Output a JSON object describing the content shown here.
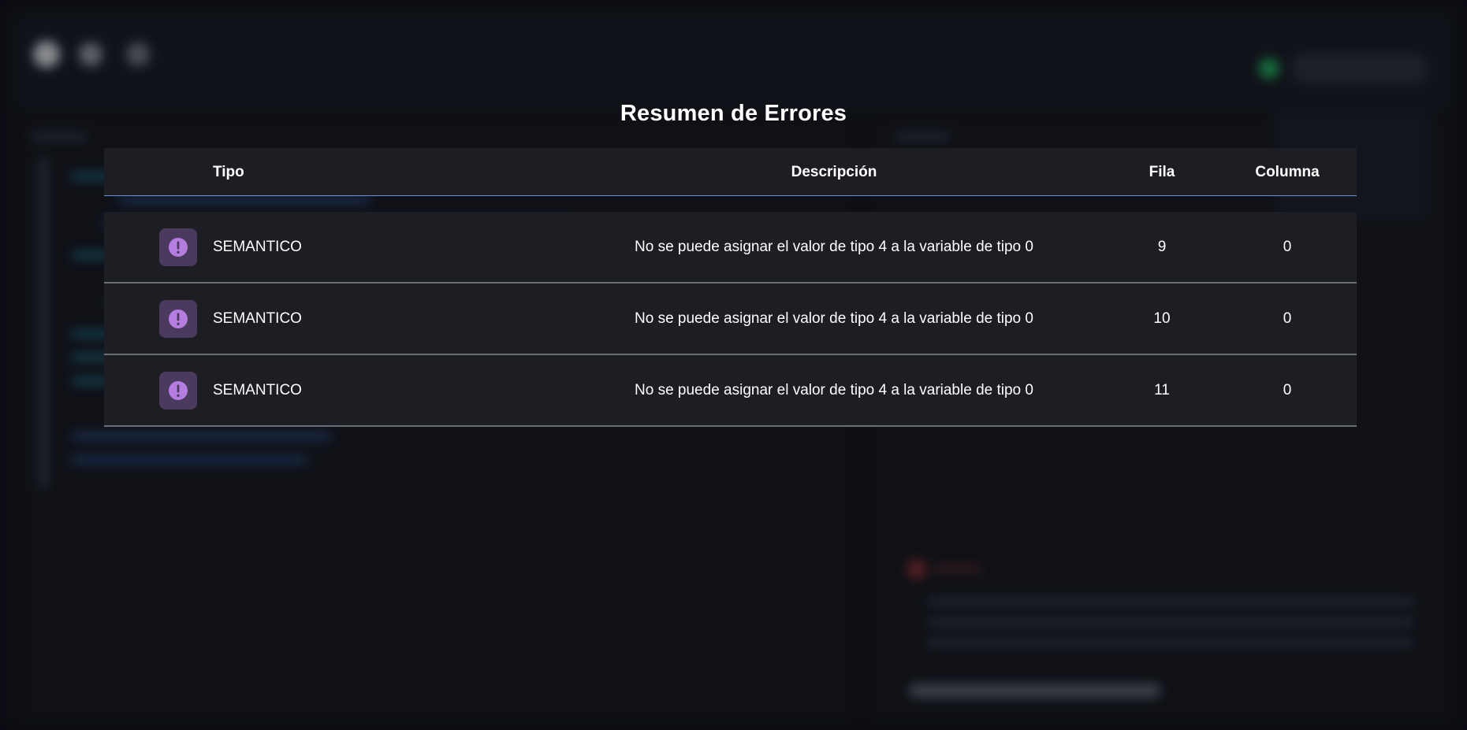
{
  "modal": {
    "title": "Resumen de Errores",
    "columns": {
      "tipo": "Tipo",
      "descripcion": "Descripción",
      "fila": "Fila",
      "columna": "Columna"
    },
    "rows": [
      {
        "tipo": "SEMANTICO",
        "icon": "alert-icon",
        "descripcion": "No se puede asignar el valor de tipo 4 a la variable de tipo 0",
        "fila": "9",
        "columna": "0"
      },
      {
        "tipo": "SEMANTICO",
        "icon": "alert-icon",
        "descripcion": "No se puede asignar el valor de tipo 4 a la variable de tipo 0",
        "fila": "10",
        "columna": "0"
      },
      {
        "tipo": "SEMANTICO",
        "icon": "alert-icon",
        "descripcion": "No se puede asignar el valor de tipo 4 a la variable de tipo 0",
        "fila": "11",
        "columna": "0"
      }
    ]
  },
  "colors": {
    "header_underline": "#6d8ed8",
    "icon_bg": "#4a3a5e",
    "icon_fg": "#b57ddf",
    "row_bg": "#1c1e23"
  }
}
